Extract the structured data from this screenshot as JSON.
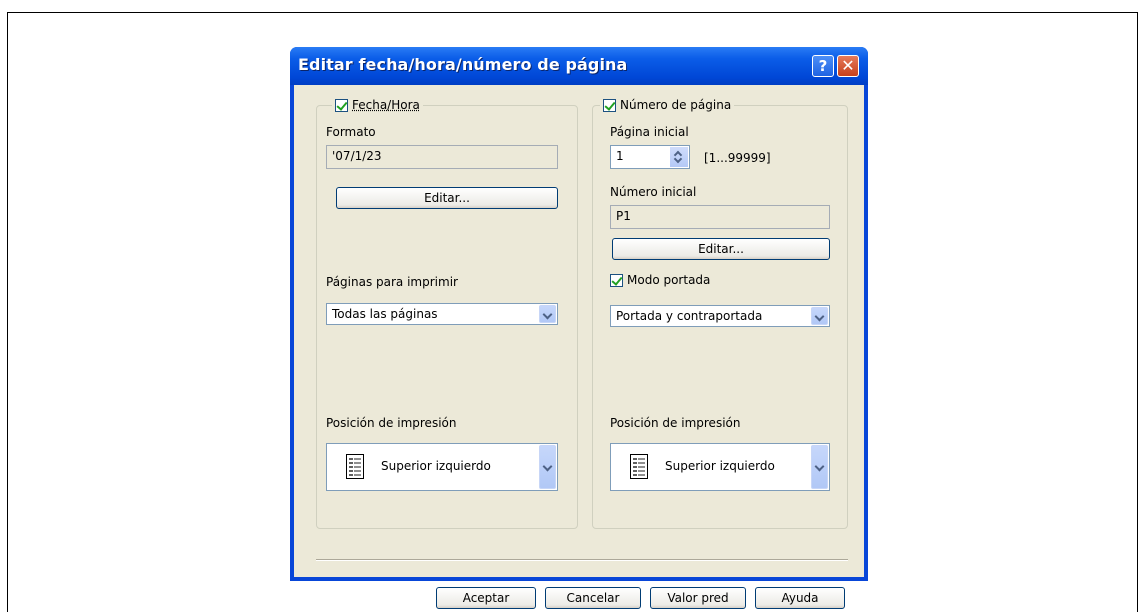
{
  "dialog": {
    "title": "Editar fecha/hora/número de página",
    "help_label": "?",
    "close_label": "✕"
  },
  "left": {
    "group_label": "Fecha/Hora",
    "group_checked": true,
    "format_label": "Formato",
    "format_value": "'07/1/23",
    "edit_button": "Editar...",
    "pages_label": "Páginas para imprimir",
    "pages_value": "Todas las páginas",
    "position_label": "Posición de impresión",
    "position_value": "Superior izquierdo"
  },
  "right": {
    "group_label": "Número de página",
    "group_checked": true,
    "start_page_label": "Página inicial",
    "start_page_value": "1",
    "range_text": "[1...99999]",
    "start_number_label": "Número inicial",
    "start_number_value": "P1",
    "edit_button": "Editar...",
    "cover_mode_label": "Modo portada",
    "cover_mode_checked": true,
    "cover_value": "Portada y contraportada",
    "position_label": "Posición de impresión",
    "position_value": "Superior izquierdo"
  },
  "footer": {
    "ok": "Aceptar",
    "cancel": "Cancelar",
    "default": "Valor pred",
    "help": "Ayuda"
  }
}
